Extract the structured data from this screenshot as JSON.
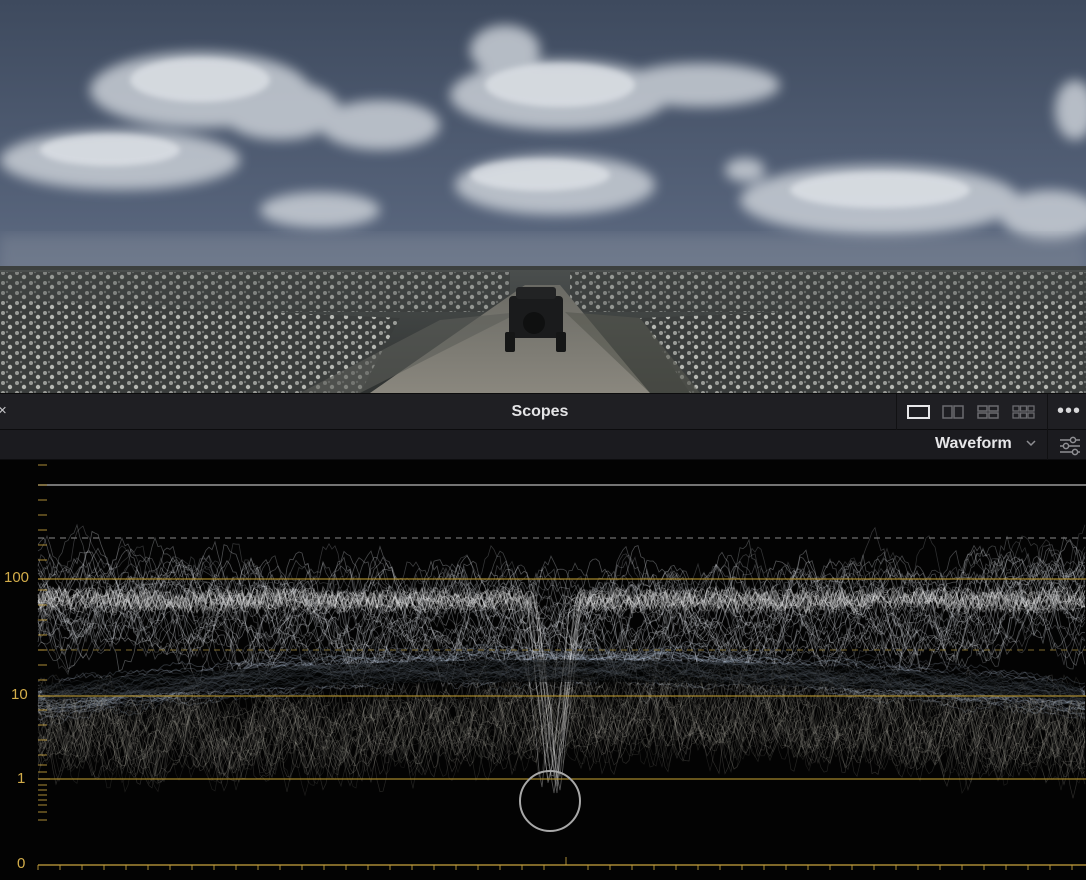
{
  "panel": {
    "title": "Scopes",
    "close_icon": "close-icon",
    "layout_icons": [
      "single-view-icon",
      "dual-view-icon",
      "quad-view-icon",
      "six-view-icon"
    ],
    "more_icon": "more-options-icon"
  },
  "toolbar": {
    "scope_type": "Waveform",
    "chevron_icon": "chevron-down-icon",
    "settings_icon": "sliders-icon"
  },
  "waveform": {
    "scale": "log",
    "ticks": [
      {
        "label": "100",
        "value": 100
      },
      {
        "label": "10",
        "value": 10
      },
      {
        "label": "1",
        "value": 1
      },
      {
        "label": "0",
        "value": 0
      }
    ],
    "guide_color": "#b4922f",
    "tick_color": "#c9a33e",
    "trace_color": "#d9dde3"
  },
  "viewer": {
    "image_icon": "video-frame-image"
  }
}
